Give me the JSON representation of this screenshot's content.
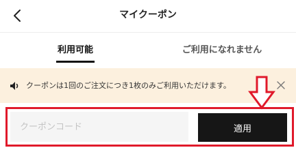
{
  "header": {
    "title": "マイクーポン",
    "back_icon": "chevron-left-icon"
  },
  "tabs": [
    {
      "label": "利用可能",
      "active": true
    },
    {
      "label": "ご利用になれません",
      "active": false
    }
  ],
  "notice": {
    "icon": "speaker-icon",
    "text": "クーポンは1回のご注文につき1枚のみご利用いただけます。",
    "close_icon": "close-icon",
    "background": "#fcf0de"
  },
  "coupon": {
    "placeholder": "クーポンコード",
    "value": "",
    "apply_label": "適用"
  },
  "annotation": {
    "arrow_icon": "down-arrow-icon",
    "highlight_color": "#e0192a"
  }
}
